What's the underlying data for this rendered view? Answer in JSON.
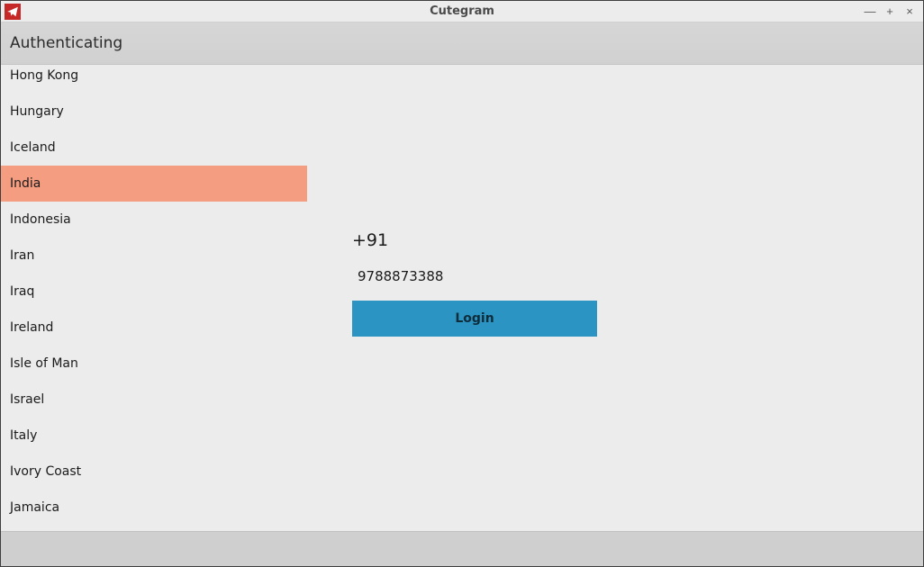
{
  "window": {
    "title": "Cutegram"
  },
  "header": {
    "text": "Authenticating"
  },
  "countries": [
    {
      "name": "Hong Kong",
      "selected": false
    },
    {
      "name": "Hungary",
      "selected": false
    },
    {
      "name": "Iceland",
      "selected": false
    },
    {
      "name": "India",
      "selected": true
    },
    {
      "name": "Indonesia",
      "selected": false
    },
    {
      "name": "Iran",
      "selected": false
    },
    {
      "name": "Iraq",
      "selected": false
    },
    {
      "name": "Ireland",
      "selected": false
    },
    {
      "name": "Isle of Man",
      "selected": false
    },
    {
      "name": "Israel",
      "selected": false
    },
    {
      "name": "Italy",
      "selected": false
    },
    {
      "name": "Ivory Coast",
      "selected": false
    },
    {
      "name": "Jamaica",
      "selected": false
    }
  ],
  "form": {
    "calling_code": "+91",
    "phone_value": "9788873388",
    "login_label": "Login"
  }
}
